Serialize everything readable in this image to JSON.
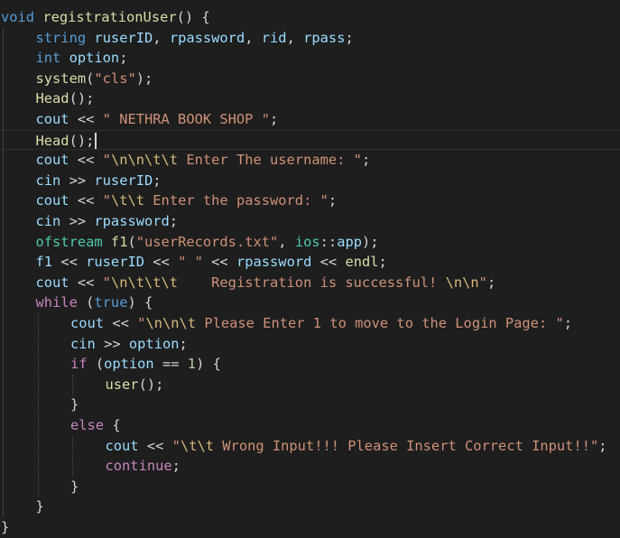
{
  "editor": {
    "theme_colors": {
      "background": "#1e1e1e",
      "keyword": "#569cd6",
      "control": "#c586c0",
      "function": "#dcdcaa",
      "variable": "#9cdcfe",
      "string": "#ce9178",
      "escape": "#d7ba7d",
      "number": "#b5cea8",
      "type": "#4ec9b0",
      "default": "#d4d4d4"
    },
    "current_line_index": 6,
    "lines": [
      {
        "indent": 0,
        "tokens": [
          [
            "kw",
            "void"
          ],
          [
            "pun",
            " "
          ],
          [
            "fn",
            "registrationUser"
          ],
          [
            "pun",
            "() {"
          ]
        ]
      },
      {
        "indent": 1,
        "tokens": [
          [
            "kw",
            "string"
          ],
          [
            "pun",
            " "
          ],
          [
            "var",
            "ruserID"
          ],
          [
            "pun",
            ", "
          ],
          [
            "var",
            "rpassword"
          ],
          [
            "pun",
            ", "
          ],
          [
            "var",
            "rid"
          ],
          [
            "pun",
            ", "
          ],
          [
            "var",
            "rpass"
          ],
          [
            "pun",
            ";"
          ]
        ]
      },
      {
        "indent": 1,
        "tokens": [
          [
            "kw",
            "int"
          ],
          [
            "pun",
            " "
          ],
          [
            "var",
            "option"
          ],
          [
            "pun",
            ";"
          ]
        ]
      },
      {
        "indent": 1,
        "tokens": [
          [
            "fn",
            "system"
          ],
          [
            "pun",
            "("
          ],
          [
            "str",
            "\"cls\""
          ],
          [
            "pun",
            ");"
          ]
        ]
      },
      {
        "indent": 1,
        "tokens": [
          [
            "fn",
            "Head"
          ],
          [
            "pun",
            "();"
          ]
        ]
      },
      {
        "indent": 1,
        "tokens": [
          [
            "var",
            "cout"
          ],
          [
            "pun",
            " << "
          ],
          [
            "str",
            "\" NETHRA BOOK SHOP \""
          ],
          [
            "pun",
            ";"
          ]
        ]
      },
      {
        "indent": 1,
        "tokens": [
          [
            "fn",
            "Head"
          ],
          [
            "pun",
            "();"
          ]
        ]
      },
      {
        "indent": 1,
        "tokens": [
          [
            "var",
            "cout"
          ],
          [
            "pun",
            " << "
          ],
          [
            "str",
            "\""
          ],
          [
            "esc",
            "\\n\\n\\t\\t"
          ],
          [
            "str",
            " Enter The username: \""
          ],
          [
            "pun",
            ";"
          ]
        ]
      },
      {
        "indent": 1,
        "tokens": [
          [
            "var",
            "cin"
          ],
          [
            "pun",
            " >> "
          ],
          [
            "var",
            "ruserID"
          ],
          [
            "pun",
            ";"
          ]
        ]
      },
      {
        "indent": 1,
        "tokens": [
          [
            "var",
            "cout"
          ],
          [
            "pun",
            " << "
          ],
          [
            "str",
            "\""
          ],
          [
            "esc",
            "\\t\\t"
          ],
          [
            "str",
            " Enter the password: \""
          ],
          [
            "pun",
            ";"
          ]
        ]
      },
      {
        "indent": 1,
        "tokens": [
          [
            "var",
            "cin"
          ],
          [
            "pun",
            " >> "
          ],
          [
            "var",
            "rpassword"
          ],
          [
            "pun",
            ";"
          ]
        ]
      },
      {
        "indent": 1,
        "tokens": [
          [
            "typ",
            "ofstream"
          ],
          [
            "pun",
            " "
          ],
          [
            "fn",
            "f1"
          ],
          [
            "pun",
            "("
          ],
          [
            "str",
            "\"userRecords.txt\""
          ],
          [
            "pun",
            ", "
          ],
          [
            "typ",
            "ios"
          ],
          [
            "pun",
            "::"
          ],
          [
            "var",
            "app"
          ],
          [
            "pun",
            ");"
          ]
        ]
      },
      {
        "indent": 1,
        "tokens": [
          [
            "var",
            "f1"
          ],
          [
            "pun",
            " << "
          ],
          [
            "var",
            "ruserID"
          ],
          [
            "pun",
            " << "
          ],
          [
            "str",
            "\" \""
          ],
          [
            "pun",
            " << "
          ],
          [
            "var",
            "rpassword"
          ],
          [
            "pun",
            " << "
          ],
          [
            "fn",
            "endl"
          ],
          [
            "pun",
            ";"
          ]
        ]
      },
      {
        "indent": 1,
        "tokens": [
          [
            "var",
            "cout"
          ],
          [
            "pun",
            " << "
          ],
          [
            "str",
            "\""
          ],
          [
            "esc",
            "\\n\\t\\t\\t"
          ],
          [
            "str",
            "    Registration is successful! "
          ],
          [
            "esc",
            "\\n\\n"
          ],
          [
            "str",
            "\""
          ],
          [
            "pun",
            ";"
          ]
        ]
      },
      {
        "indent": 1,
        "tokens": [
          [
            "ctl",
            "while"
          ],
          [
            "pun",
            " ("
          ],
          [
            "kw",
            "true"
          ],
          [
            "pun",
            ") {"
          ]
        ]
      },
      {
        "indent": 2,
        "tokens": [
          [
            "var",
            "cout"
          ],
          [
            "pun",
            " << "
          ],
          [
            "str",
            "\""
          ],
          [
            "esc",
            "\\n\\n\\t"
          ],
          [
            "str",
            " Please Enter 1 to move to the Login Page: \""
          ],
          [
            "pun",
            ";"
          ]
        ]
      },
      {
        "indent": 2,
        "tokens": [
          [
            "var",
            "cin"
          ],
          [
            "pun",
            " >> "
          ],
          [
            "var",
            "option"
          ],
          [
            "pun",
            ";"
          ]
        ]
      },
      {
        "indent": 2,
        "tokens": [
          [
            "ctl",
            "if"
          ],
          [
            "pun",
            " ("
          ],
          [
            "var",
            "option"
          ],
          [
            "pun",
            " == "
          ],
          [
            "num",
            "1"
          ],
          [
            "pun",
            ") {"
          ]
        ]
      },
      {
        "indent": 3,
        "tokens": [
          [
            "fn",
            "user"
          ],
          [
            "pun",
            "();"
          ]
        ]
      },
      {
        "indent": 2,
        "tokens": [
          [
            "pun",
            "}"
          ]
        ]
      },
      {
        "indent": 2,
        "tokens": [
          [
            "ctl",
            "else"
          ],
          [
            "pun",
            " {"
          ]
        ]
      },
      {
        "indent": 3,
        "tokens": [
          [
            "var",
            "cout"
          ],
          [
            "pun",
            " << "
          ],
          [
            "str",
            "\""
          ],
          [
            "esc",
            "\\t\\t"
          ],
          [
            "str",
            " Wrong Input!!! Please Insert Correct Input!!\""
          ],
          [
            "pun",
            ";"
          ]
        ]
      },
      {
        "indent": 3,
        "tokens": [
          [
            "ctl",
            "continue"
          ],
          [
            "pun",
            ";"
          ]
        ]
      },
      {
        "indent": 2,
        "tokens": [
          [
            "pun",
            "}"
          ]
        ]
      },
      {
        "indent": 1,
        "tokens": [
          [
            "pun",
            "}"
          ]
        ]
      },
      {
        "indent": 0,
        "tokens": [
          [
            "pun",
            "}"
          ]
        ]
      }
    ]
  }
}
